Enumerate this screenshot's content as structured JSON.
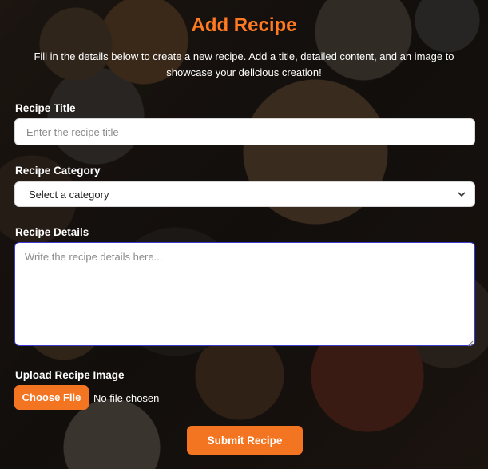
{
  "page": {
    "title": "Add Recipe",
    "description": "Fill in the details below to create a new recipe. Add a title, detailed content, and an image to showcase your delicious creation!"
  },
  "form": {
    "title_label": "Recipe Title",
    "title_placeholder": "Enter the recipe title",
    "category_label": "Recipe Category",
    "category_selected": "Select a category",
    "details_label": "Recipe Details",
    "details_placeholder": "Write the recipe details here...",
    "image_label": "Upload Recipe Image",
    "choose_file_label": "Choose File",
    "file_status": "No file chosen",
    "submit_label": "Submit Recipe"
  },
  "icons": {
    "select": "chevron-down-icon",
    "textarea": "resize-grip-icon"
  },
  "colors": {
    "accent": "#f37521",
    "title": "#ff7a22",
    "focus_border": "#3b3bd0"
  }
}
